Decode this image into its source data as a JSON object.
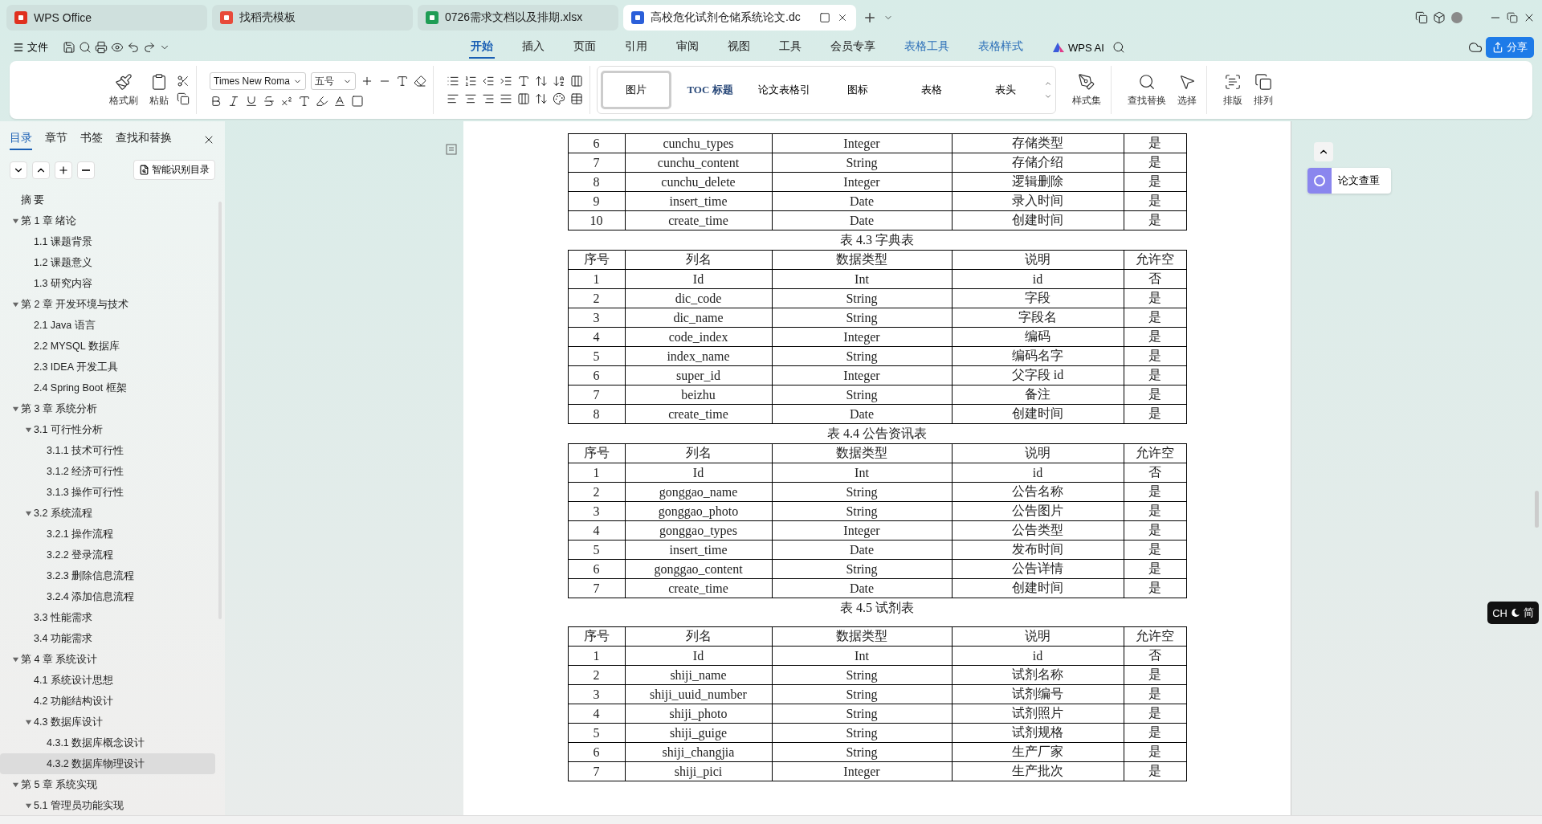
{
  "browser_tabs": [
    {
      "label": "WPS Office",
      "kind": "wps",
      "selected": false
    },
    {
      "label": "找稻壳模板",
      "kind": "template",
      "selected": false
    },
    {
      "label": "0726需求文档以及排期.xlsx",
      "kind": "sheet",
      "selected": false
    },
    {
      "label": "高校危化试剂仓储系统论文.dc",
      "kind": "doc",
      "selected": true
    }
  ],
  "file_menu": "文件",
  "ribbon_tabs": [
    {
      "label": "开始",
      "selected": true,
      "contextual": false
    },
    {
      "label": "插入",
      "selected": false,
      "contextual": false
    },
    {
      "label": "页面",
      "selected": false,
      "contextual": false
    },
    {
      "label": "引用",
      "selected": false,
      "contextual": false
    },
    {
      "label": "审阅",
      "selected": false,
      "contextual": false
    },
    {
      "label": "视图",
      "selected": false,
      "contextual": false
    },
    {
      "label": "工具",
      "selected": false,
      "contextual": false
    },
    {
      "label": "会员专享",
      "selected": false,
      "contextual": false
    },
    {
      "label": "表格工具",
      "selected": false,
      "contextual": true
    },
    {
      "label": "表格样式",
      "selected": false,
      "contextual": true
    }
  ],
  "ai_button": "WPS AI",
  "share_button": "分享",
  "ribbon": {
    "format_painter": "格式刷",
    "paste": "粘贴",
    "font_name": "Times New Roma",
    "font_size": "五号",
    "styles": [
      {
        "label": "图片",
        "selected": true
      },
      {
        "label": "TOC 标题",
        "selected": false
      },
      {
        "label": "论文表格引",
        "selected": false
      },
      {
        "label": "图标",
        "selected": false
      },
      {
        "label": "表格",
        "selected": false
      },
      {
        "label": "表头",
        "selected": false
      }
    ],
    "style_set": "样式集",
    "tools": [
      "查找替换",
      "选择",
      "排版",
      "排列"
    ]
  },
  "sidebar": {
    "tabs": [
      {
        "label": "目录",
        "selected": true
      },
      {
        "label": "章节",
        "selected": false
      },
      {
        "label": "书签",
        "selected": false
      },
      {
        "label": "查找和替换",
        "selected": false
      }
    ],
    "smart_button": "智能识别目录",
    "outline": [
      {
        "label": "摘 要",
        "selected": false
      },
      {
        "label": "第 1 章  绪论",
        "selected": false,
        "expanded": true,
        "children": [
          {
            "label": "1.1  课题背景",
            "selected": false
          },
          {
            "label": "1.2  课题意义",
            "selected": false
          },
          {
            "label": "1.3  研究内容",
            "selected": false
          }
        ]
      },
      {
        "label": "第 2 章  开发环境与技术",
        "selected": false,
        "expanded": true,
        "children": [
          {
            "label": "2.1 Java 语言",
            "selected": false
          },
          {
            "label": "2.2 MYSQL 数据库",
            "selected": false
          },
          {
            "label": "2.3 IDEA 开发工具",
            "selected": false
          },
          {
            "label": "2.4 Spring Boot 框架",
            "selected": false
          }
        ]
      },
      {
        "label": "第 3 章  系统分析",
        "selected": false,
        "expanded": true,
        "children": [
          {
            "label": "3.1  可行性分析",
            "selected": false,
            "expanded": true,
            "children": [
              {
                "label": "3.1.1  技术可行性",
                "selected": false
              },
              {
                "label": "3.1.2  经济可行性",
                "selected": false
              },
              {
                "label": "3.1.3  操作可行性",
                "selected": false
              }
            ]
          },
          {
            "label": "3.2  系统流程",
            "selected": false,
            "expanded": true,
            "children": [
              {
                "label": "3.2.1  操作流程",
                "selected": false
              },
              {
                "label": "3.2.2  登录流程",
                "selected": false
              },
              {
                "label": "3.2.3  删除信息流程",
                "selected": false
              },
              {
                "label": "3.2.4  添加信息流程",
                "selected": false
              }
            ]
          },
          {
            "label": "3.3  性能需求",
            "selected": false
          },
          {
            "label": "3.4  功能需求",
            "selected": false
          }
        ]
      },
      {
        "label": "第 4 章  系统设计",
        "selected": false,
        "expanded": true,
        "children": [
          {
            "label": "4.1  系统设计思想",
            "selected": false
          },
          {
            "label": "4.2  功能结构设计",
            "selected": false
          },
          {
            "label": "4.3  数据库设计",
            "selected": false,
            "expanded": true,
            "children": [
              {
                "label": "4.3.1  数据库概念设计",
                "selected": false
              },
              {
                "label": "4.3.2  数据库物理设计",
                "selected": true
              }
            ]
          }
        ]
      },
      {
        "label": "第 5 章  系统实现",
        "selected": false,
        "expanded": true,
        "children": [
          {
            "label": "5.1  管理员功能实现",
            "selected": false,
            "expanded": true
          }
        ]
      }
    ]
  },
  "document": {
    "tables": [
      {
        "rows": [
          [
            "6",
            "cunchu_types",
            "Integer",
            "存储类型",
            "是"
          ],
          [
            "7",
            "cunchu_content",
            "String",
            "存储介绍",
            "是"
          ],
          [
            "8",
            "cunchu_delete",
            "Integer",
            "逻辑删除",
            "是"
          ],
          [
            "9",
            "insert_time",
            "Date",
            "录入时间",
            "是"
          ],
          [
            "10",
            "create_time",
            "Date",
            "创建时间",
            "是"
          ]
        ]
      },
      {
        "caption": "表 4.3 字典表",
        "columns": [
          "序号",
          "列名",
          "数据类型",
          "说明",
          "允许空"
        ],
        "rows": [
          [
            "1",
            "Id",
            "Int",
            "id",
            "否"
          ],
          [
            "2",
            "dic_code",
            "String",
            "字段",
            "是"
          ],
          [
            "3",
            "dic_name",
            "String",
            "字段名",
            "是"
          ],
          [
            "4",
            "code_index",
            "Integer",
            "编码",
            "是"
          ],
          [
            "5",
            "index_name",
            "String",
            "编码名字",
            "是"
          ],
          [
            "6",
            "super_id",
            "Integer",
            "父字段 id",
            "是"
          ],
          [
            "7",
            "beizhu",
            "String",
            "备注",
            "是"
          ],
          [
            "8",
            "create_time",
            "Date",
            "创建时间",
            "是"
          ]
        ]
      },
      {
        "caption": "表 4.4 公告资讯表",
        "columns": [
          "序号",
          "列名",
          "数据类型",
          "说明",
          "允许空"
        ],
        "rows": [
          [
            "1",
            "Id",
            "Int",
            "id",
            "否"
          ],
          [
            "2",
            "gonggao_name",
            "String",
            "公告名称",
            "是"
          ],
          [
            "3",
            "gonggao_photo",
            "String",
            "公告图片",
            "是"
          ],
          [
            "4",
            "gonggao_types",
            "Integer",
            "公告类型",
            "是"
          ],
          [
            "5",
            "insert_time",
            "Date",
            "发布时间",
            "是"
          ],
          [
            "6",
            "gonggao_content",
            "String",
            "公告详情",
            "是"
          ],
          [
            "7",
            "create_time",
            "Date",
            "创建时间",
            "是"
          ]
        ]
      },
      {
        "caption": "表 4.5 试剂表",
        "columns": [
          "序号",
          "列名",
          "数据类型",
          "说明",
          "允许空"
        ],
        "rows": [
          [
            "1",
            "Id",
            "Int",
            "id",
            "否"
          ],
          [
            "2",
            "shiji_name",
            "String",
            "试剂名称",
            "是"
          ],
          [
            "3",
            "shiji_uuid_number",
            "String",
            "试剂编号",
            "是"
          ],
          [
            "4",
            "shiji_photo",
            "String",
            "试剂照片",
            "是"
          ],
          [
            "5",
            "shiji_guige",
            "String",
            "试剂规格",
            "是"
          ],
          [
            "6",
            "shiji_changjia",
            "String",
            "生产厂家",
            "是"
          ],
          [
            "7",
            "shiji_pici",
            "Integer",
            "生产批次",
            "是"
          ]
        ]
      }
    ]
  },
  "right_panel": {
    "plagiarism_button": "论文查重",
    "ime_badge": {
      "language": "CH",
      "script": "简"
    }
  }
}
